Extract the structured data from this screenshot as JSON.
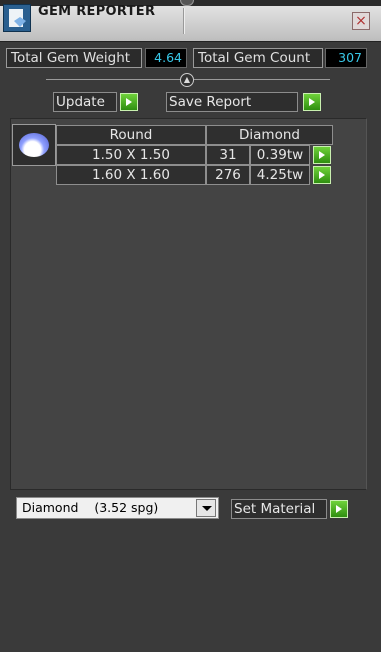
{
  "header": {
    "title": "GEM REPORTER"
  },
  "stats": {
    "weight_label": "Total Gem Weight",
    "weight_value": "4.64",
    "count_label": "Total Gem Count",
    "count_value": "307"
  },
  "actions": {
    "update_label": "Update",
    "save_label": "Save Report"
  },
  "table": {
    "headers": [
      "Round",
      "Diamond"
    ],
    "rows": [
      {
        "size": "1.50 X 1.50",
        "count": "31",
        "weight": "0.39tw"
      },
      {
        "size": "1.60 X 1.60",
        "count": "276",
        "weight": "4.25tw"
      }
    ]
  },
  "material": {
    "selected": "Diamond    (3.52 spg)",
    "set_label": "Set Material"
  },
  "colors": {
    "panel_bg": "#3a3a3a",
    "value_text": "#39c8e8",
    "go_button": "#3fa81c"
  },
  "icons": [
    "gem-reporter-app-icon",
    "close-icon",
    "splitter-knob-icon",
    "go-arrow-icon",
    "gem-thumbnail",
    "dropdown-arrow-icon"
  ]
}
